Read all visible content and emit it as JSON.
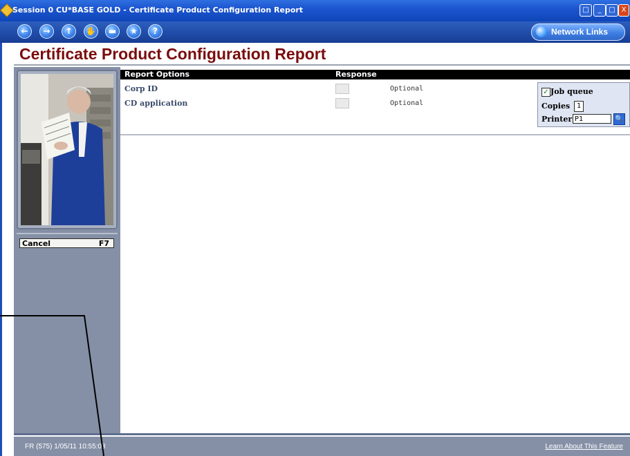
{
  "window": {
    "title": "Session 0 CU*BASE GOLD - Certificate Product Configuration Report",
    "buttons": [
      "□",
      "_",
      "□",
      "X"
    ]
  },
  "toolbar": {
    "nav_icons": [
      "back-icon",
      "forward-icon",
      "up-icon",
      "hand-icon",
      "print-icon",
      "star-icon",
      "help-icon"
    ],
    "nav_glyphs": [
      "←",
      "→",
      "↑",
      "✋",
      "▬",
      "★",
      "?"
    ],
    "network_links_label": "Network Links"
  },
  "header": {
    "page_title": "Certificate Product Configuration Report"
  },
  "sidebar": {
    "cancel_label": "Cancel",
    "cancel_key": "F7"
  },
  "options": {
    "col_report_options": "Report Options",
    "col_response": "Response",
    "rows": [
      {
        "label": "Corp ID",
        "value": "",
        "note": "Optional"
      },
      {
        "label": "CD application",
        "value": "",
        "note": "Optional"
      }
    ]
  },
  "job": {
    "job_queue_label": "Job queue",
    "job_queue_checked": true,
    "copies_label": "Copies",
    "copies_value": "1",
    "printer_label": "Printer",
    "printer_value": "P1"
  },
  "status": {
    "left_text": "FR (575) 1/05/11 10:55:08",
    "learn_link": "Learn About This Feature"
  },
  "colors": {
    "title_red": "#7a0c0c",
    "sidebar_gray": "#8590a6",
    "titlebar_blue": "#1b55cf"
  }
}
